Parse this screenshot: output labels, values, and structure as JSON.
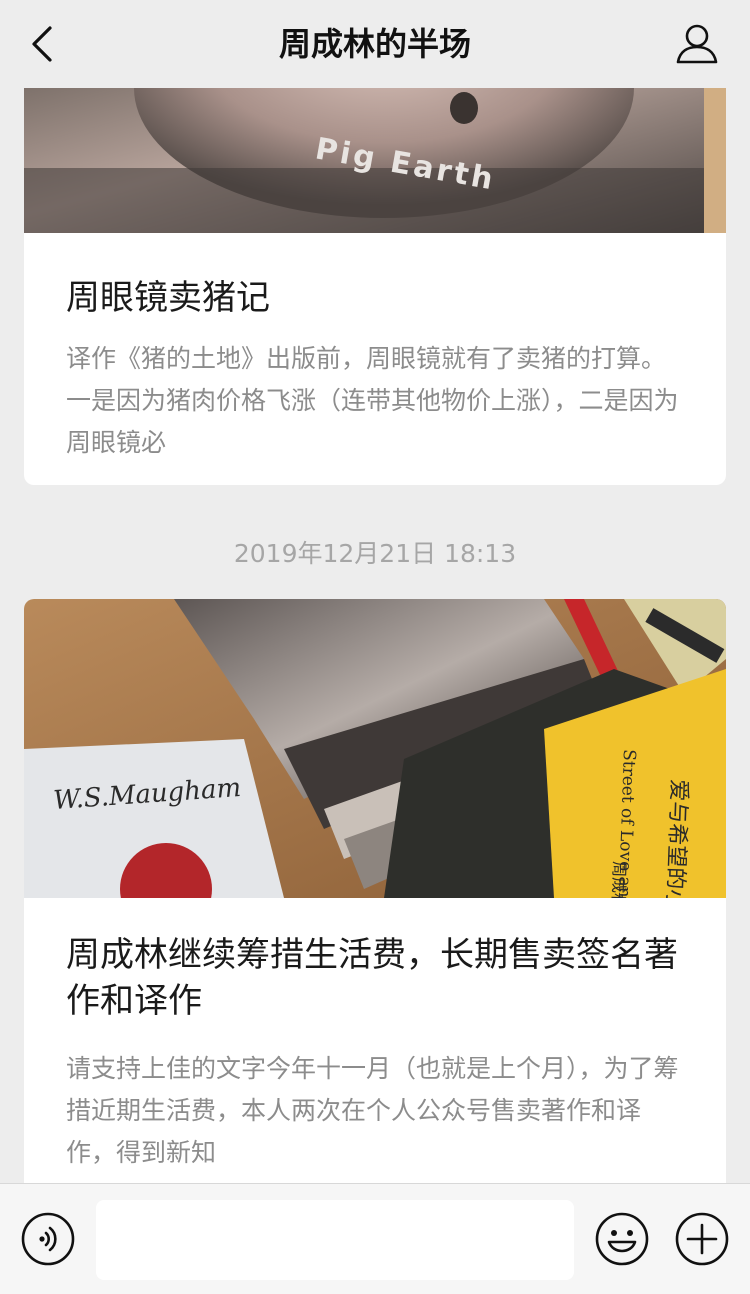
{
  "navbar": {
    "title": "周成林的半场",
    "back_icon": "chevron-left-icon",
    "profile_icon": "person-icon"
  },
  "messages": [
    {
      "cover_text": "Pig Earth",
      "title": "周眼镜卖猪记",
      "digest": "译作《猪的土地》出版前，周眼镜就有了卖猪的打算。一是因为猪肉价格飞涨（连带其他物价上涨），二是因为周眼镜必"
    },
    {
      "timestamp": "2019年12月21日 18:13",
      "cover_texts": {
        "author": "W.S.Maugham",
        "book_title_en": "Street of Love and Hope",
        "book_title_cn": "爱与希望的小街",
        "book_author": "周成林"
      },
      "title": "周成林继续筹措生活费，长期售卖签名著作和译作",
      "digest": "请支持上佳的文字今年十一月（也就是上个月），为了筹措近期生活费，本人两次在个人公众号售卖著作和译作，得到新知"
    }
  ],
  "inputbar": {
    "input_value": "",
    "voice_icon": "voice-icon",
    "emoji_icon": "emoji-icon",
    "plus_icon": "plus-icon"
  },
  "colors": {
    "background": "#ededed",
    "card": "#ffffff",
    "title_text": "#1a1a1a",
    "digest_text": "#8c8c8c",
    "timestamp_text": "#a6a6a6"
  }
}
